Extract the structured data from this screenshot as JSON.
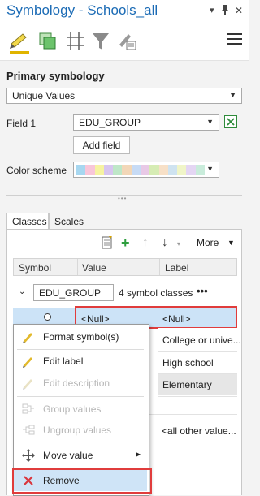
{
  "window": {
    "title": "Symbology - Schools_all",
    "pin_glyph": "📌",
    "close_glyph": "✕",
    "dropdown_glyph": "▾"
  },
  "primary": {
    "heading": "Primary symbology",
    "renderer": "Unique Values",
    "field1_label": "Field 1",
    "field1_value": "EDU_GROUP",
    "add_field": "Add field",
    "color_scheme_label": "Color scheme",
    "color_scheme_colors": [
      "#a7d7f0",
      "#f8c6d9",
      "#f6f3a2",
      "#d7c6ef",
      "#bfe7c8",
      "#f2d7b8",
      "#c7dbf5",
      "#e8c9e6",
      "#d6ecb4",
      "#f7e0c7",
      "#cfe3f0",
      "#f0f5c8",
      "#e4d6f3",
      "#c9ecdb"
    ]
  },
  "tabs": {
    "classes": "Classes",
    "scales": "Scales"
  },
  "class_toolbar": {
    "more": "More"
  },
  "grid": {
    "col_symbol": "Symbol",
    "col_value": "Value",
    "col_label": "Label",
    "group_field": "EDU_GROUP",
    "group_count": "4 symbol classes",
    "group_menu": "•••",
    "rows": [
      {
        "value": "<Null>",
        "label": "<Null>"
      },
      {
        "value": "",
        "label": "College or unive..."
      },
      {
        "value": "",
        "label": "High school"
      },
      {
        "value": "",
        "label": "Elementary"
      },
      {
        "value": "",
        "label": "<all other value..."
      }
    ]
  },
  "context_menu": {
    "format_symbol": "Format symbol(s)",
    "edit_label": "Edit label",
    "edit_description": "Edit description",
    "group_values": "Group values",
    "ungroup_values": "Ungroup values",
    "move_value": "Move value",
    "remove": "Remove"
  },
  "colors": {
    "accent": "#1b6bb5",
    "highlight": "#e03c3c",
    "selection": "#cce3f7",
    "add_green": "#2e9e3e",
    "remove_red": "#d9363e"
  }
}
